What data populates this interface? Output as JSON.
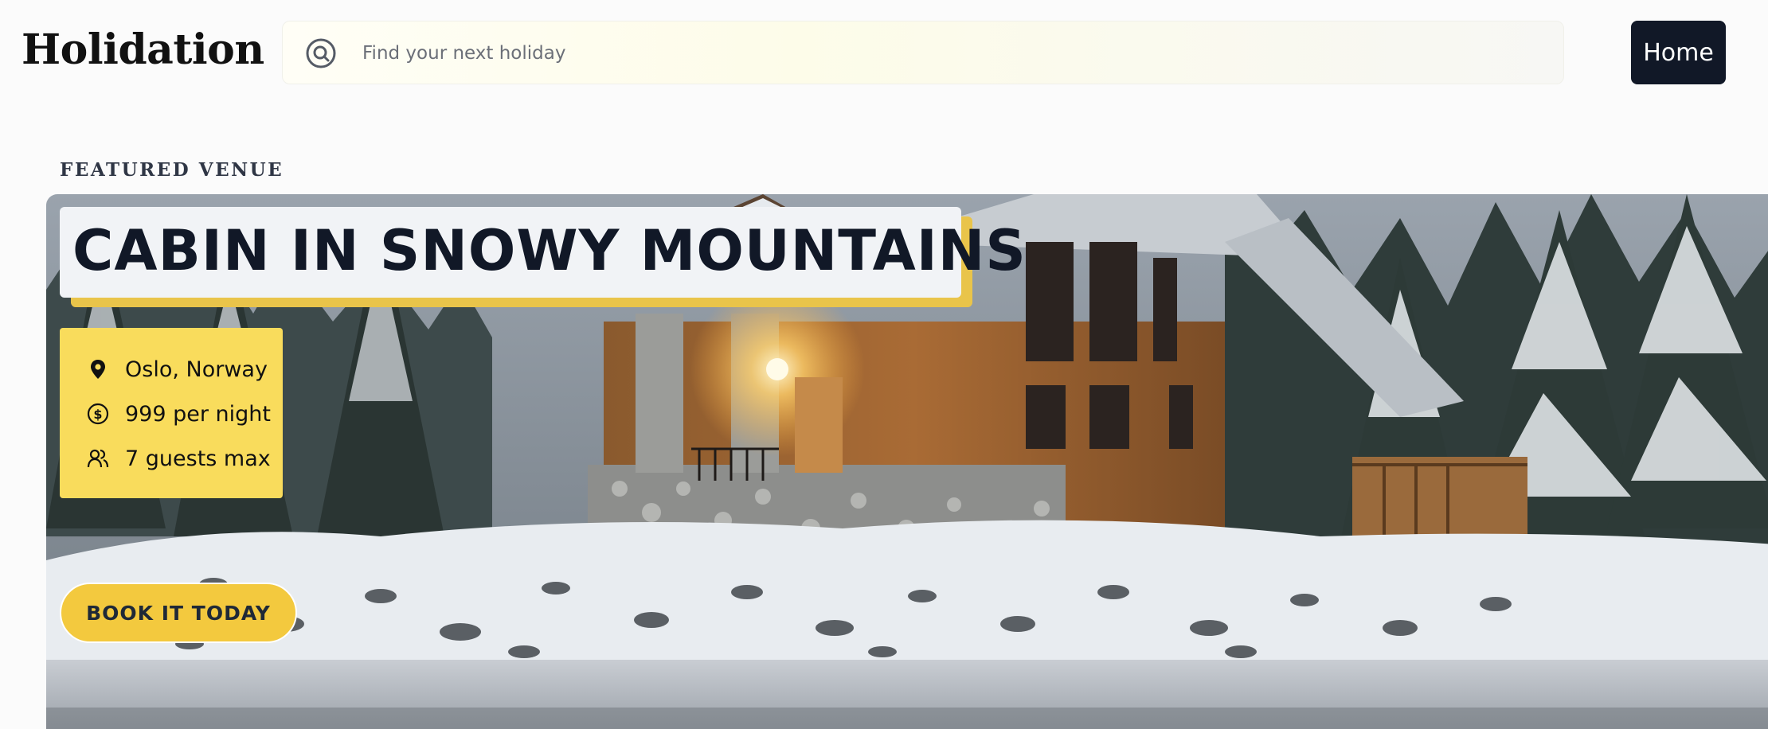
{
  "header": {
    "logo": "Holidation",
    "search_placeholder": "Find your next holiday",
    "home_label": "Home"
  },
  "featured": {
    "section_label": "FEATURED VENUE",
    "title": "CABIN IN SNOWY MOUNTAINS",
    "location": "Oslo, Norway",
    "price": "999 per night",
    "guests": "7 guests max",
    "cta_label": "BOOK IT TODAY"
  },
  "icons": {
    "search": "search-icon",
    "location": "map-pin-icon",
    "price": "dollar-icon",
    "guests": "users-icon"
  },
  "colors": {
    "brand_dark": "#111827",
    "accent_yellow": "#f9dc5c",
    "cta_yellow": "#f3c93e"
  }
}
